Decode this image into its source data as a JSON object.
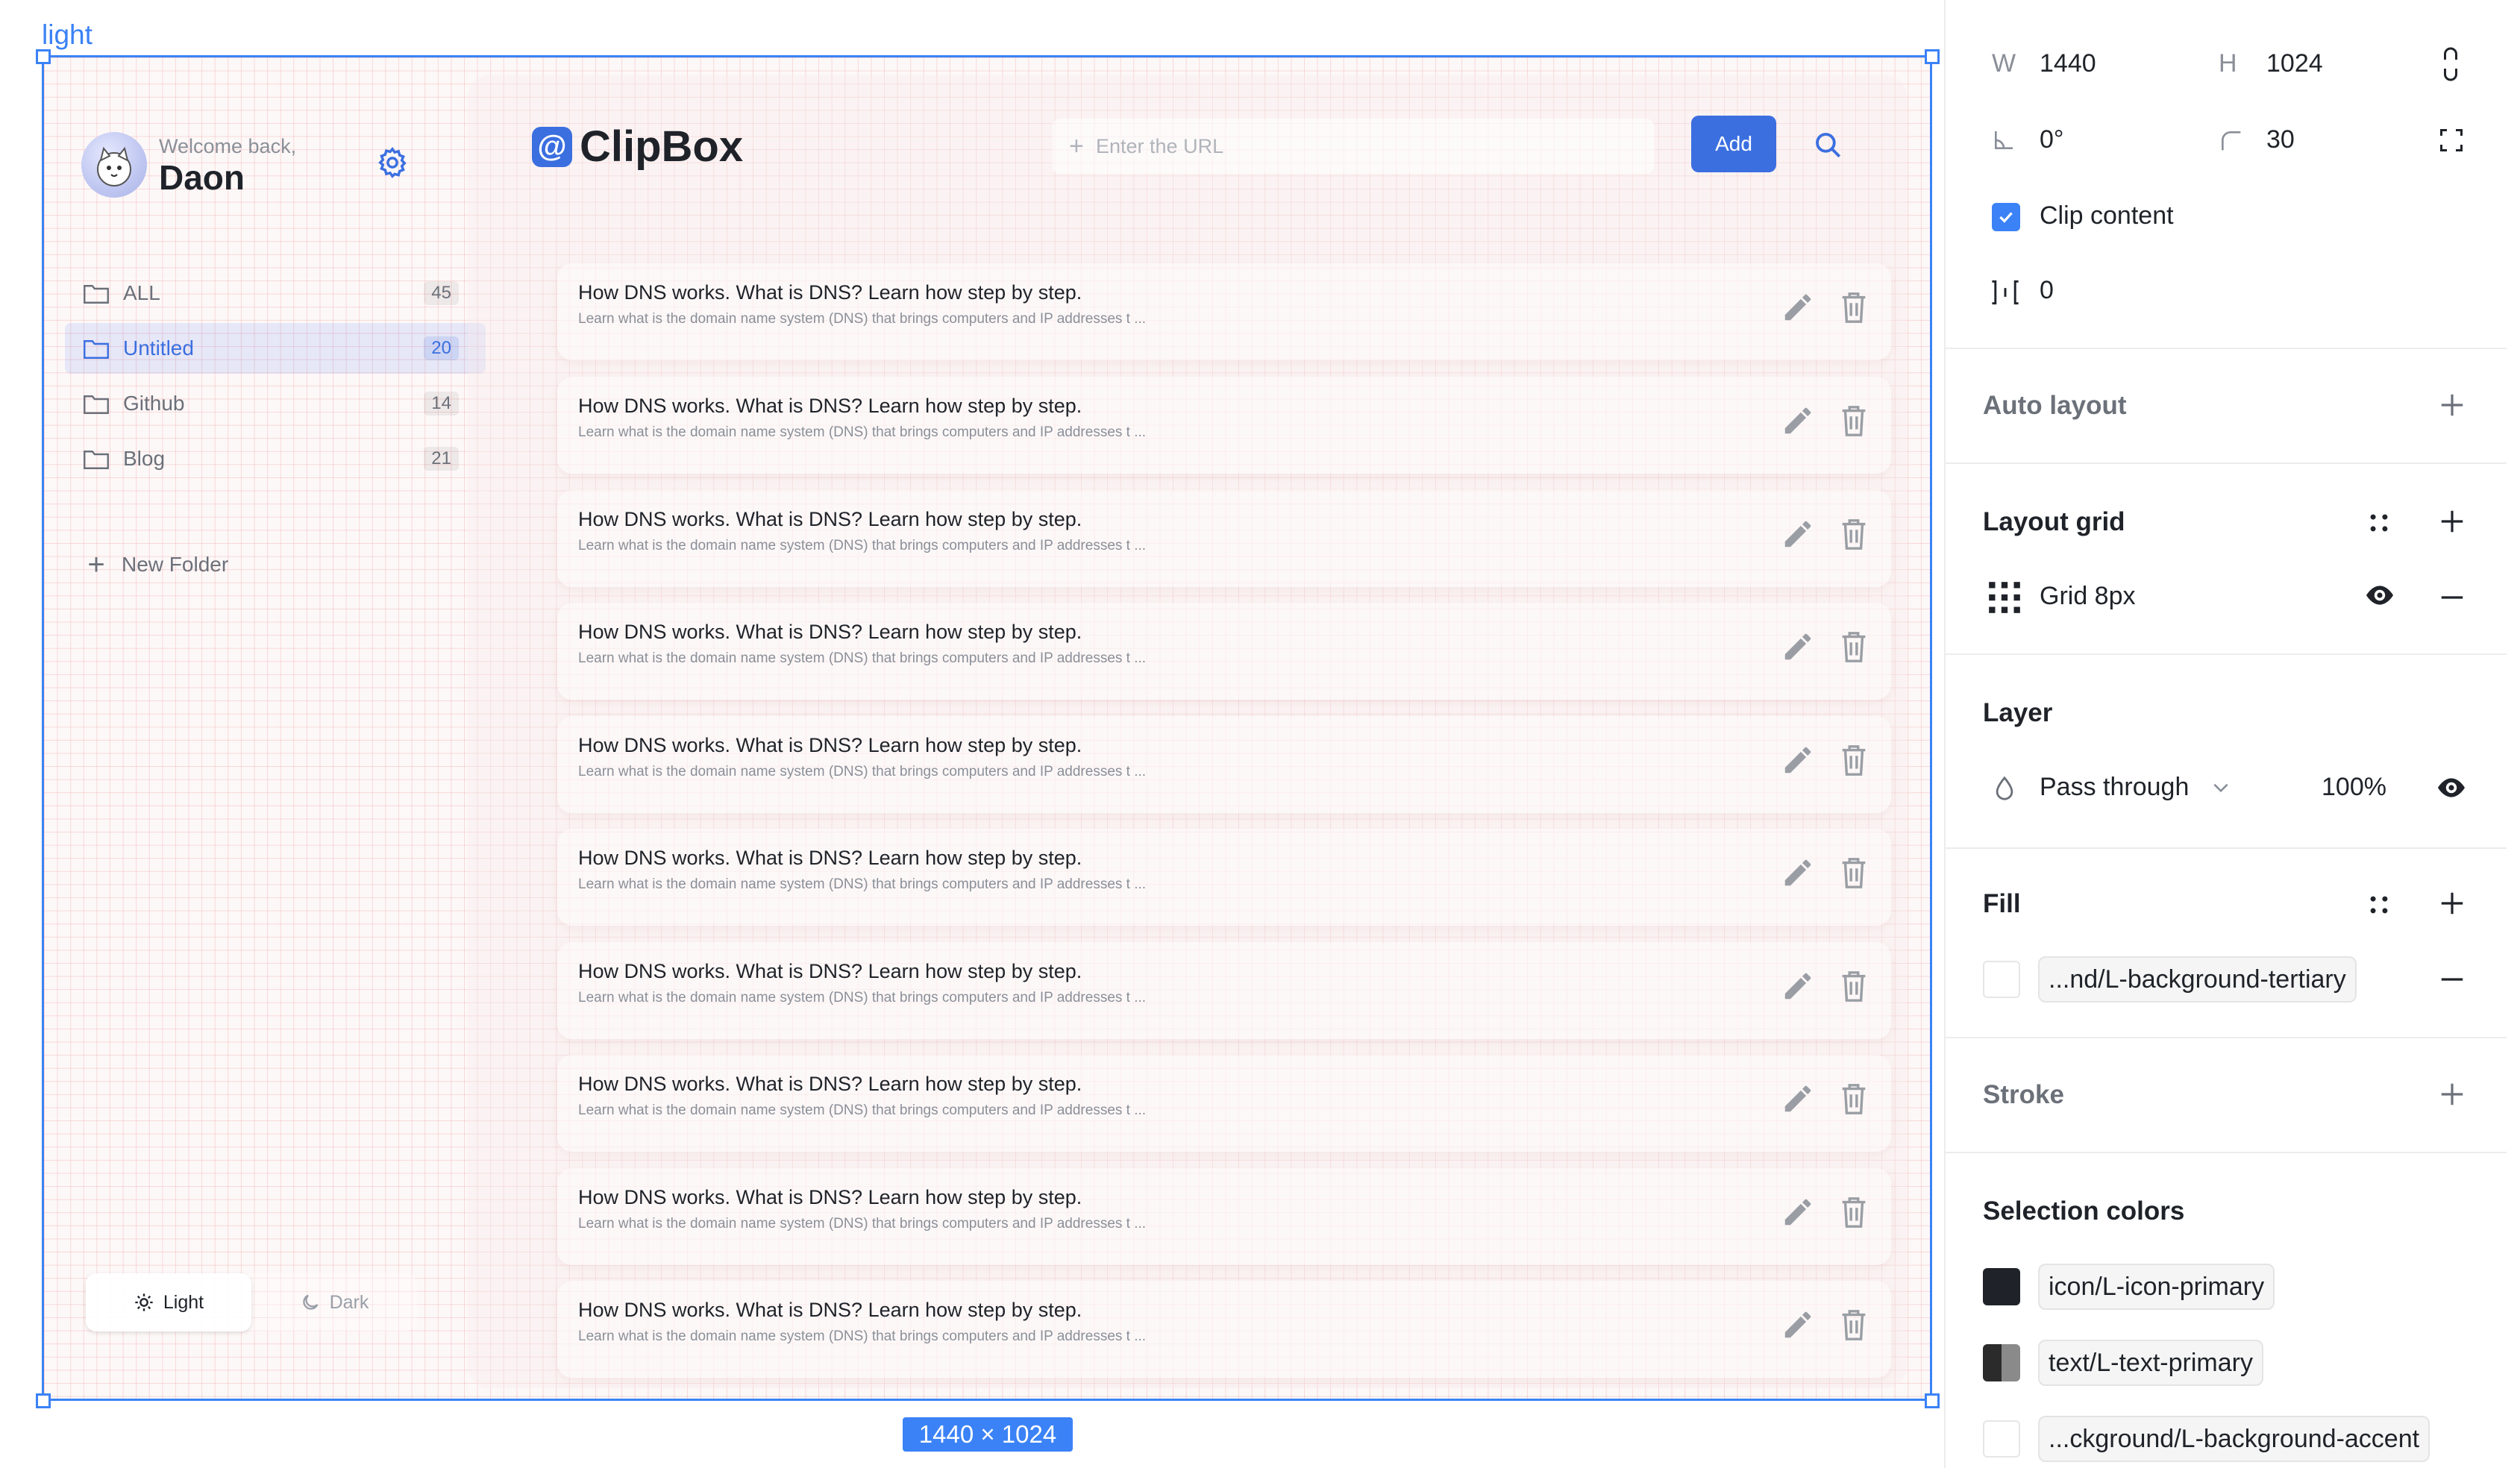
{
  "canvas": {
    "frame_label": "light",
    "size_badge": "1440 × 1024"
  },
  "app": {
    "welcome": "Welcome back,",
    "username": "Daon",
    "logo_text": "ClipBox",
    "url_placeholder": "Enter the URL",
    "add_label": "Add",
    "folders": [
      {
        "label": "ALL",
        "count": "45",
        "active": false
      },
      {
        "label": "Untitled",
        "count": "20",
        "active": true
      },
      {
        "label": "Github",
        "count": "14",
        "active": false
      },
      {
        "label": "Blog",
        "count": "21",
        "active": false
      }
    ],
    "new_folder": "New Folder",
    "theme": {
      "light": "Light",
      "dark": "Dark"
    },
    "clips": [
      {
        "title": "How DNS works. What is DNS? Learn how step by step.",
        "desc": "Learn what is the domain name system (DNS) that brings computers and IP addresses t ..."
      },
      {
        "title": "How DNS works. What is DNS? Learn how step by step.",
        "desc": "Learn what is the domain name system (DNS) that brings computers and IP addresses t ..."
      },
      {
        "title": "How DNS works. What is DNS? Learn how step by step.",
        "desc": "Learn what is the domain name system (DNS) that brings computers and IP addresses t ..."
      },
      {
        "title": "How DNS works. What is DNS? Learn how step by step.",
        "desc": "Learn what is the domain name system (DNS) that brings computers and IP addresses t ..."
      },
      {
        "title": "How DNS works. What is DNS? Learn how step by step.",
        "desc": "Learn what is the domain name system (DNS) that brings computers and IP addresses t ..."
      },
      {
        "title": "How DNS works. What is DNS? Learn how step by step.",
        "desc": "Learn what is the domain name system (DNS) that brings computers and IP addresses t ..."
      },
      {
        "title": "How DNS works. What is DNS? Learn how step by step.",
        "desc": "Learn what is the domain name system (DNS) that brings computers and IP addresses t ..."
      },
      {
        "title": "How DNS works. What is DNS? Learn how step by step.",
        "desc": "Learn what is the domain name system (DNS) that brings computers and IP addresses t ..."
      },
      {
        "title": "How DNS works. What is DNS? Learn how step by step.",
        "desc": "Learn what is the domain name system (DNS) that brings computers and IP addresses t ..."
      },
      {
        "title": "How DNS works. What is DNS? Learn how step by step.",
        "desc": "Learn what is the domain name system (DNS) that brings computers and IP addresses t ..."
      }
    ]
  },
  "panel": {
    "w_label": "W",
    "w_value": "1440",
    "h_label": "H",
    "h_value": "1024",
    "rotation": "0°",
    "radius": "30",
    "clip_content": "Clip content",
    "spacing": "0",
    "auto_layout": "Auto layout",
    "layout_grid": "Layout grid",
    "grid_name": "Grid 8px",
    "layer": "Layer",
    "blend_mode": "Pass through",
    "opacity": "100%",
    "fill": "Fill",
    "fill_style": "...nd/L-background-tertiary",
    "stroke": "Stroke",
    "selection_colors": "Selection colors",
    "colors": [
      {
        "name": "icon/L-icon-primary",
        "hex": "#1f2329"
      },
      {
        "name": "text/L-text-primary",
        "hex": "#2b2b2b"
      },
      {
        "name": "...ckground/L-background-accent",
        "hex": "#ffffff"
      }
    ]
  },
  "colors": {
    "accent": "#3b6fe0",
    "selection": "#3b82f6"
  }
}
